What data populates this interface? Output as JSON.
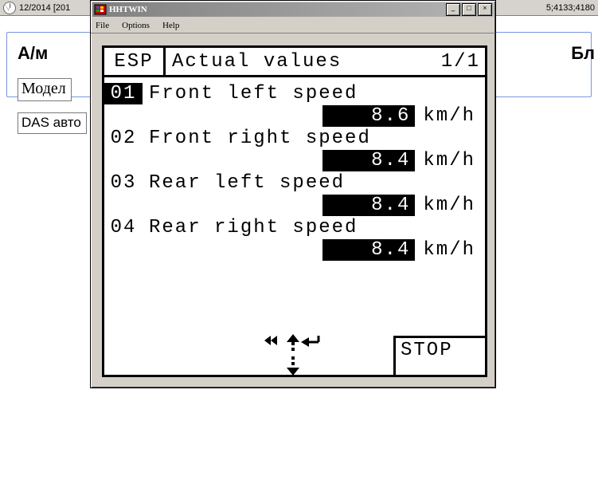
{
  "titlebar": {
    "left": "12/2014 [201",
    "right": "5;4133;4180"
  },
  "background": {
    "am": "А/м",
    "bl": "Бл",
    "model": "Модел",
    "das": "DAS авто"
  },
  "window": {
    "title": "HHTWIN",
    "menu": {
      "file": "File",
      "options": "Options",
      "help": "Help"
    },
    "buttons": {
      "min": "_",
      "max": "□",
      "close": "×"
    }
  },
  "screen": {
    "esp": "ESP",
    "title": "Actual values",
    "page": "1/1",
    "rows": [
      {
        "num": "01",
        "selected": true,
        "label": "Front left speed",
        "value": "8.6",
        "unit": "km/h"
      },
      {
        "num": "02",
        "selected": false,
        "label": "Front right speed",
        "value": "8.4",
        "unit": "km/h"
      },
      {
        "num": "03",
        "selected": false,
        "label": "Rear left speed",
        "value": "8.4",
        "unit": "km/h"
      },
      {
        "num": "04",
        "selected": false,
        "label": "Rear right speed",
        "value": "8.4",
        "unit": "km/h"
      }
    ],
    "stop": "STOP"
  }
}
